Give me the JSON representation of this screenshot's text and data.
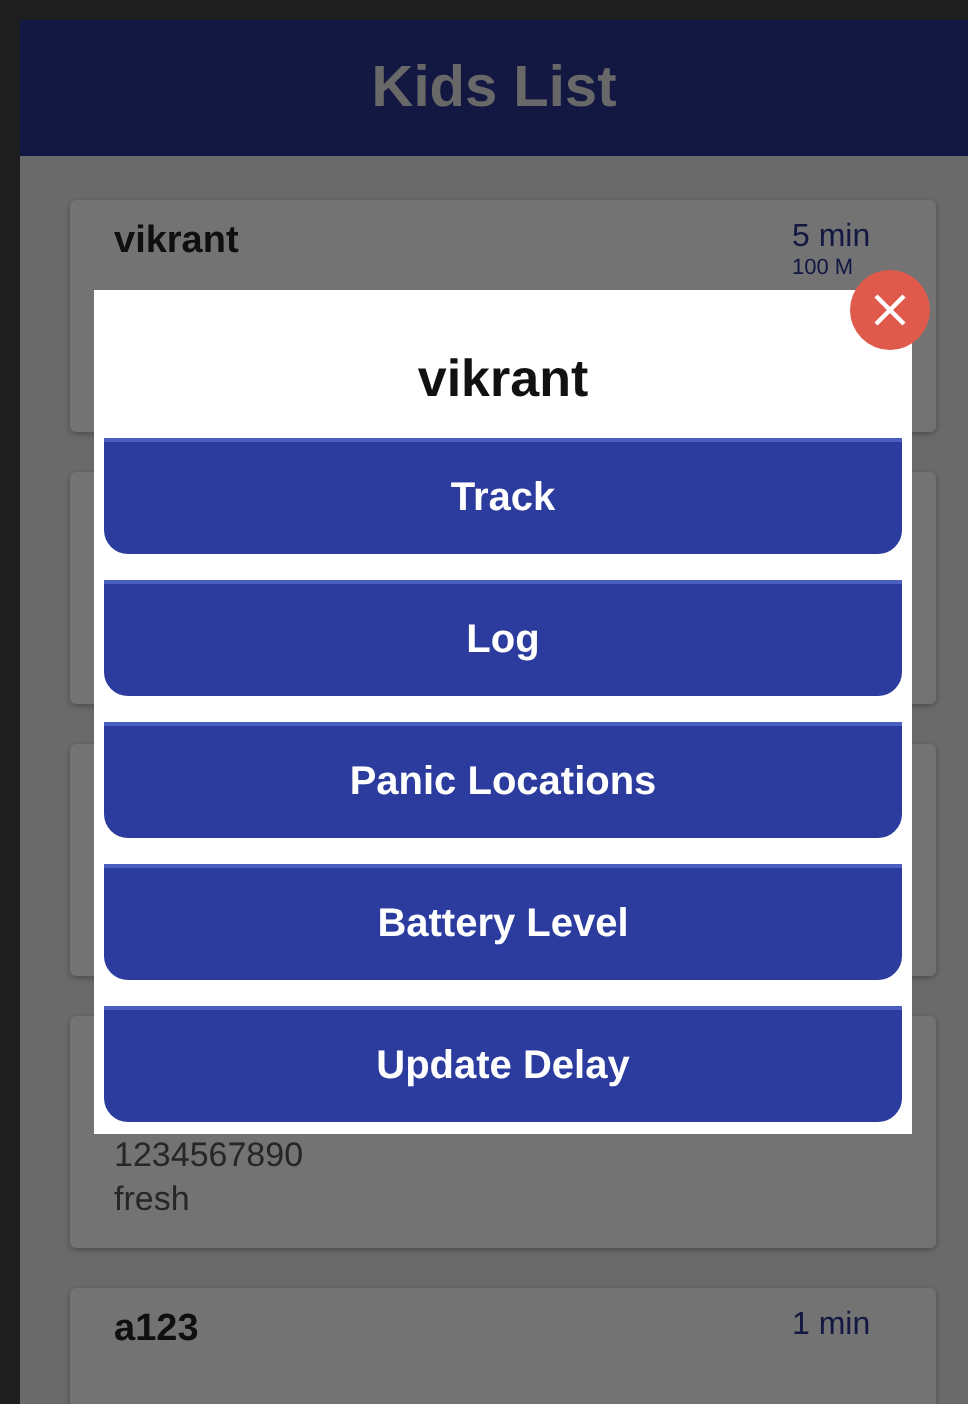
{
  "header": {
    "title": "Kids List"
  },
  "kids": [
    {
      "kind": "card",
      "name": "vikrant",
      "time": "5 min",
      "distance": "100 M"
    },
    {
      "kind": "card"
    },
    {
      "kind": "card"
    },
    {
      "kind": "card",
      "lines": [
        "1234567890",
        "fresh"
      ]
    },
    {
      "kind": "card",
      "name": "a123",
      "time": "1 min"
    }
  ],
  "dialog": {
    "title": "vikrant",
    "buttons": [
      "Track",
      "Log",
      "Panic Locations",
      "Battery Level",
      "Update Delay"
    ]
  }
}
